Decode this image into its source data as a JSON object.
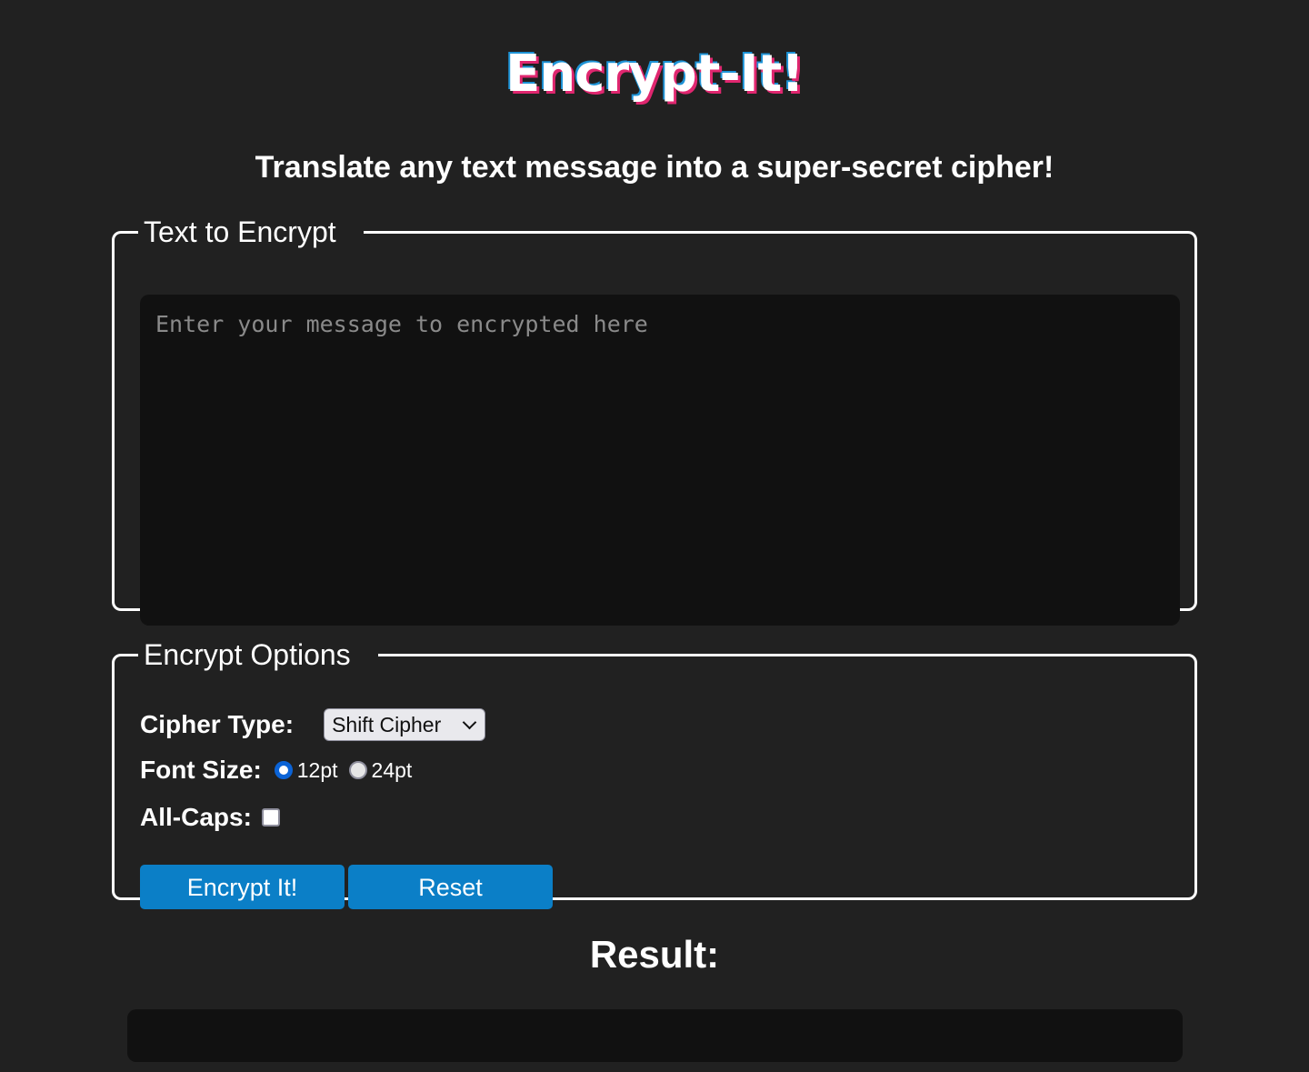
{
  "header": {
    "logo_text": "Encrypt-It!",
    "subtitle": "Translate any text message into a super-secret cipher!"
  },
  "text_section": {
    "legend": "Text to Encrypt",
    "message_value": "",
    "message_placeholder": "Enter your message to encrypted here"
  },
  "options_section": {
    "legend": "Encrypt Options",
    "cipher_type_label": "Cipher Type:",
    "cipher_type_selected": "Shift Cipher",
    "font_size_label": "Font Size:",
    "font_size_options": [
      {
        "label": "12pt",
        "checked": true
      },
      {
        "label": "24pt",
        "checked": false
      }
    ],
    "all_caps_label": "All-Caps:",
    "all_caps_checked": false,
    "encrypt_button": "Encrypt It!",
    "reset_button": "Reset"
  },
  "result": {
    "title": "Result:",
    "value": ""
  },
  "colors": {
    "background": "#212121",
    "field_background": "#111111",
    "button": "#0b7fc7",
    "logo_shadow_pink": "#e0266f",
    "logo_shadow_blue": "#1d93d6"
  }
}
